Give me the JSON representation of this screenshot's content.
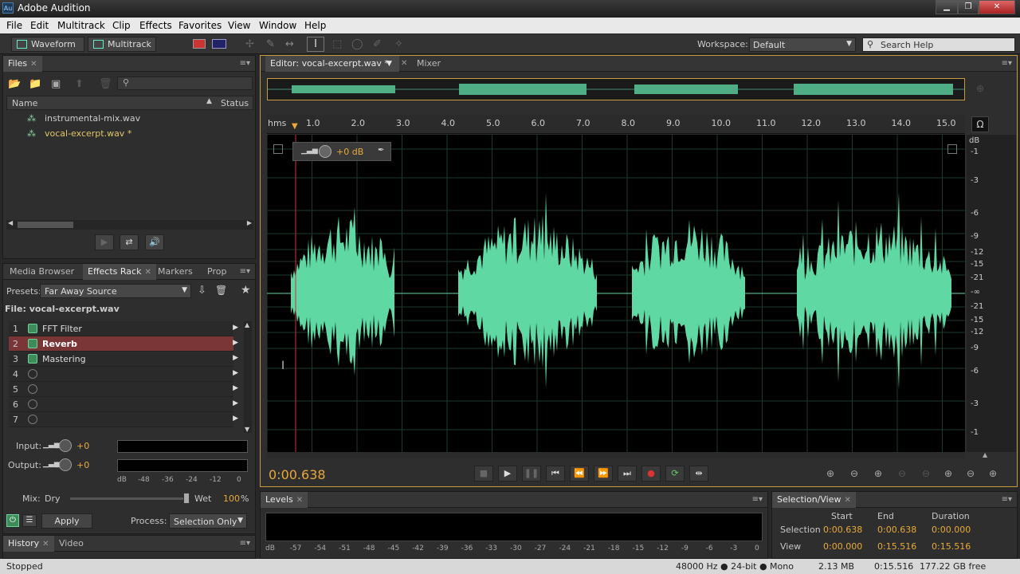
{
  "app": {
    "title": "Adobe Audition",
    "icon_label": "Au"
  },
  "menu": [
    "File",
    "Edit",
    "Multitrack",
    "Clip",
    "Effects",
    "Favorites",
    "View",
    "Window",
    "Help"
  ],
  "toolbar": {
    "waveform": "Waveform",
    "multitrack": "Multitrack",
    "workspace_label": "Workspace:",
    "workspace_value": "Default",
    "search_placeholder": "Search Help"
  },
  "files": {
    "tab": "Files",
    "col_name": "Name",
    "col_status": "Status",
    "items": [
      {
        "name": "instrumental-mix.wav",
        "active": false
      },
      {
        "name": "vocal-excerpt.wav *",
        "active": true
      }
    ]
  },
  "effects": {
    "tabs": [
      "Media Browser",
      "Effects Rack",
      "Markers",
      "Prop"
    ],
    "presets_label": "Presets:",
    "preset_value": "Far Away Source",
    "file_label": "File: vocal-excerpt.wav",
    "slots": [
      {
        "n": "1",
        "name": "FFT Filter"
      },
      {
        "n": "2",
        "name": "Reverb"
      },
      {
        "n": "3",
        "name": "Mastering"
      },
      {
        "n": "4",
        "name": ""
      },
      {
        "n": "5",
        "name": ""
      },
      {
        "n": "6",
        "name": ""
      },
      {
        "n": "7",
        "name": ""
      }
    ],
    "input_label": "Input:",
    "input_value": "+0",
    "output_label": "Output:",
    "output_value": "+0",
    "meter_scale": [
      "dB",
      "-48",
      "-36",
      "-24",
      "-12",
      "0"
    ],
    "mix_label": "Mix:",
    "dry_label": "Dry",
    "wet_label": "Wet",
    "wet_value": "100",
    "pct": "%",
    "apply": "Apply",
    "process_label": "Process:",
    "process_value": "Selection Only"
  },
  "bottomleft": {
    "tabs": [
      "History",
      "Video"
    ]
  },
  "editor": {
    "tab": "Editor: vocal-excerpt.wav *",
    "mixer_tab": "Mixer",
    "ruler_unit": "hms",
    "ruler": [
      "1.0",
      "2.0",
      "3.0",
      "4.0",
      "5.0",
      "6.0",
      "7.0",
      "8.0",
      "9.0",
      "10.0",
      "11.0",
      "12.0",
      "13.0",
      "14.0",
      "15.0"
    ],
    "db_unit": "dB",
    "db_scale": [
      "-1",
      "-3",
      "-6",
      "-9",
      "-12",
      "-15",
      "-21",
      "-∞",
      "-21",
      "-15",
      "-12",
      "-9",
      "-6",
      "-3",
      "-1"
    ],
    "hud_value": "+0 dB",
    "current_time": "0:00.638"
  },
  "levels": {
    "tab": "Levels",
    "scale": [
      "dB",
      "-57",
      "-54",
      "-51",
      "-48",
      "-45",
      "-42",
      "-39",
      "-36",
      "-33",
      "-30",
      "-27",
      "-24",
      "-21",
      "-18",
      "-15",
      "-12",
      "-9",
      "-6",
      "-3",
      "0"
    ]
  },
  "selview": {
    "tab": "Selection/View",
    "cols": [
      "Start",
      "End",
      "Duration"
    ],
    "selection_label": "Selection",
    "selection": [
      "0:00.638",
      "0:00.638",
      "0:00.000"
    ],
    "view_label": "View",
    "view": [
      "0:00.000",
      "0:15.516",
      "0:15.516"
    ]
  },
  "status": {
    "left": "Stopped",
    "format": "48000 Hz ● 24-bit ● Mono",
    "size": "2.13 MB",
    "duration": "0:15.516",
    "free": "177.22 GB free"
  },
  "colors": {
    "wave": "#5fd8a4",
    "accent": "#e8a93a",
    "reverb_row": "#7a3636"
  }
}
